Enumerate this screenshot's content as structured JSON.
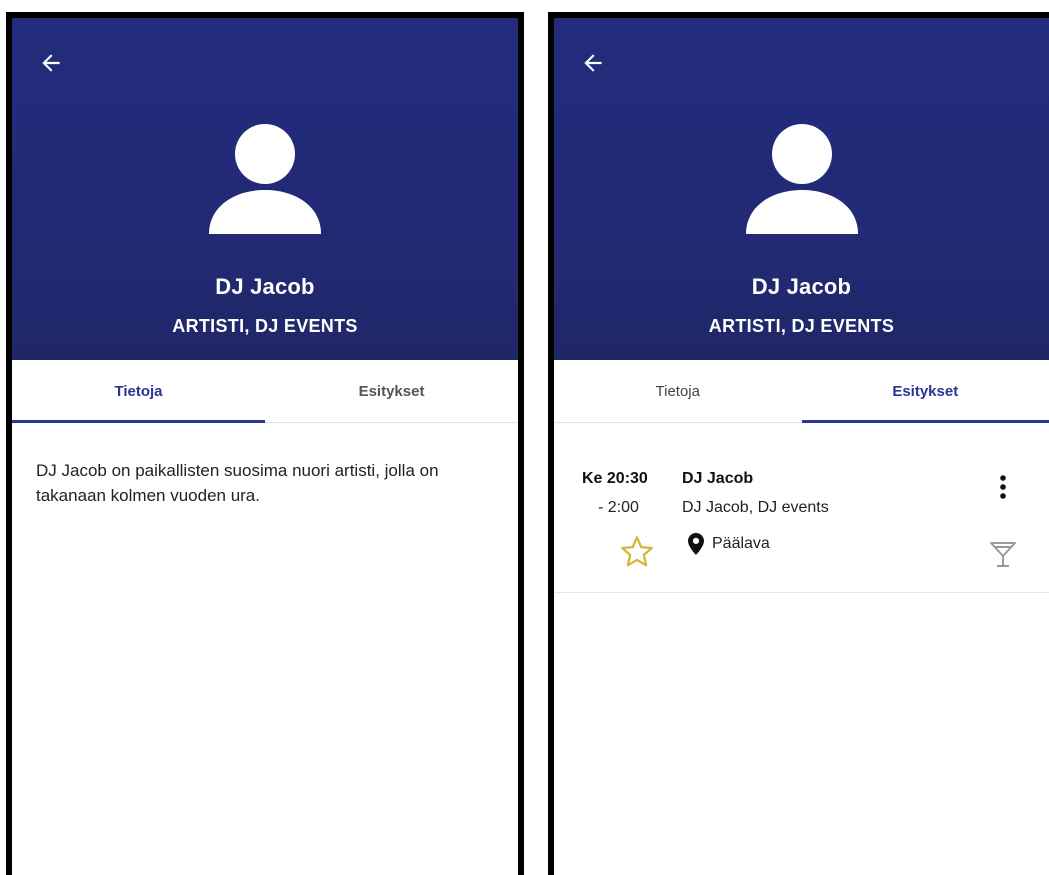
{
  "left_screen": {
    "header": {
      "back_icon": "arrow-left-icon",
      "avatar_icon": "person-icon",
      "name": "DJ Jacob",
      "subtitle": "ARTISTI, DJ EVENTS"
    },
    "tabs": [
      {
        "label": "Tietoja",
        "active": true
      },
      {
        "label": "Esitykset",
        "active": false
      }
    ],
    "about_text": "DJ Jacob on paikallisten suosima nuori artisti, jolla on takanaan kolmen vuoden ura."
  },
  "right_screen": {
    "header": {
      "back_icon": "arrow-left-icon",
      "avatar_icon": "person-icon",
      "name": "DJ Jacob",
      "subtitle": "ARTISTI, DJ EVENTS"
    },
    "tabs": [
      {
        "label": "Tietoja",
        "active": false
      },
      {
        "label": "Esitykset",
        "active": true
      }
    ],
    "event": {
      "start": "Ke 20:30",
      "end": "- 2:00",
      "title": "DJ Jacob",
      "performers": "DJ Jacob, DJ events",
      "location": "Päälava",
      "favorite_icon": "star-outline-icon",
      "menu_icon": "more-vertical-icon",
      "venue_icon": "cocktail-icon"
    }
  },
  "colors": {
    "header_bg": "#222a76",
    "accent": "#2a3494",
    "star": "#d6b43a",
    "divider": "#e2e2e2"
  }
}
